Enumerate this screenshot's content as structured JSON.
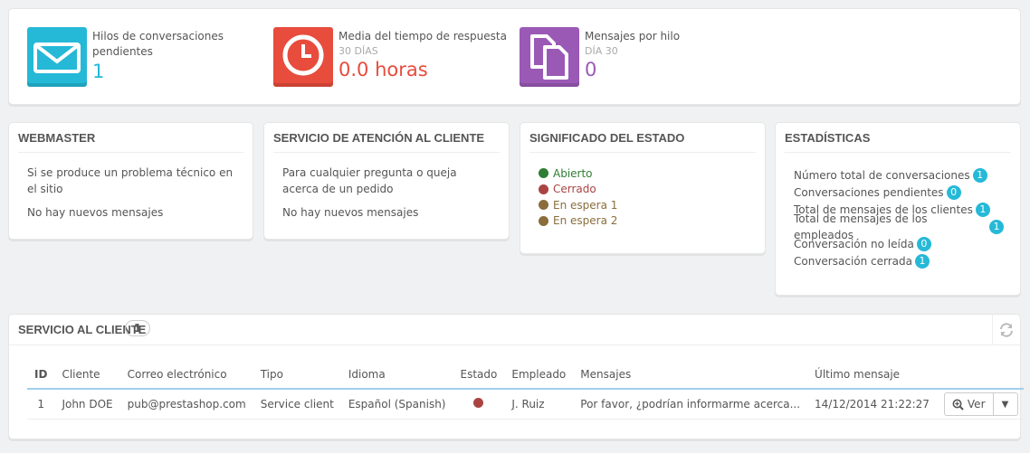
{
  "kpis": [
    {
      "icon": "envelope-icon",
      "color": "#25b9d7",
      "title": "Hilos de conversaciones pendientes",
      "subtitle": "",
      "value": "1"
    },
    {
      "icon": "clock-icon",
      "color": "#e74c3c",
      "title": "Media del tiempo de respuesta",
      "subtitle": "30 DÍAS",
      "value": "0.0 horas"
    },
    {
      "icon": "copy-icon",
      "color": "#9b59b6",
      "title": "Mensajes por hilo",
      "subtitle": "DÍA 30",
      "value": "0"
    }
  ],
  "webmaster": {
    "title": "WEBMASTER",
    "line1": "Si se produce un problema técnico en el sitio",
    "line2": "No hay nuevos mensajes"
  },
  "service": {
    "title": "SERVICIO DE ATENCIÓN AL CLIENTE",
    "line1": "Para cualquier pregunta o queja acerca de un pedido",
    "line2": "No hay nuevos mensajes"
  },
  "legend": {
    "title": "SIGNIFICADO DEL ESTADO",
    "items": [
      {
        "label": "Abierto",
        "color": "#2f7d32"
      },
      {
        "label": "Cerrado",
        "color": "#a94442"
      },
      {
        "label": "En espera 1",
        "color": "#8a6d3b"
      },
      {
        "label": "En espera 2",
        "color": "#8a6d3b"
      }
    ]
  },
  "stats": {
    "title": "ESTADÍSTICAS",
    "items": [
      {
        "label": "Número total de conversaciones",
        "value": "1"
      },
      {
        "label": "Conversaciones pendientes",
        "value": "0"
      },
      {
        "label": "Total de mensajes de los clientes",
        "value": "1"
      },
      {
        "label": "Total de mensajes de los empleados",
        "value": "1"
      },
      {
        "label": "Conversación no leída",
        "value": "0"
      },
      {
        "label": "Conversación cerrada",
        "value": "1"
      }
    ]
  },
  "customer_service": {
    "title": "SERVICIO AL CLIENTE",
    "count": "1",
    "columns": [
      "ID",
      "Cliente",
      "Correo electrónico",
      "Tipo",
      "Idioma",
      "Estado",
      "Empleado",
      "Mensajes",
      "Último mensaje"
    ],
    "rows": [
      {
        "id": "1",
        "client": "John DOE",
        "email": "pub@prestashop.com",
        "type": "Service client",
        "language": "Español (Spanish)",
        "state_color": "#a94442",
        "employee": "J. Ruiz",
        "message": "Por favor, ¿podrían informarme acerca...",
        "last_message": "14/12/2014 21:22:27",
        "view_label": "Ver"
      }
    ]
  }
}
